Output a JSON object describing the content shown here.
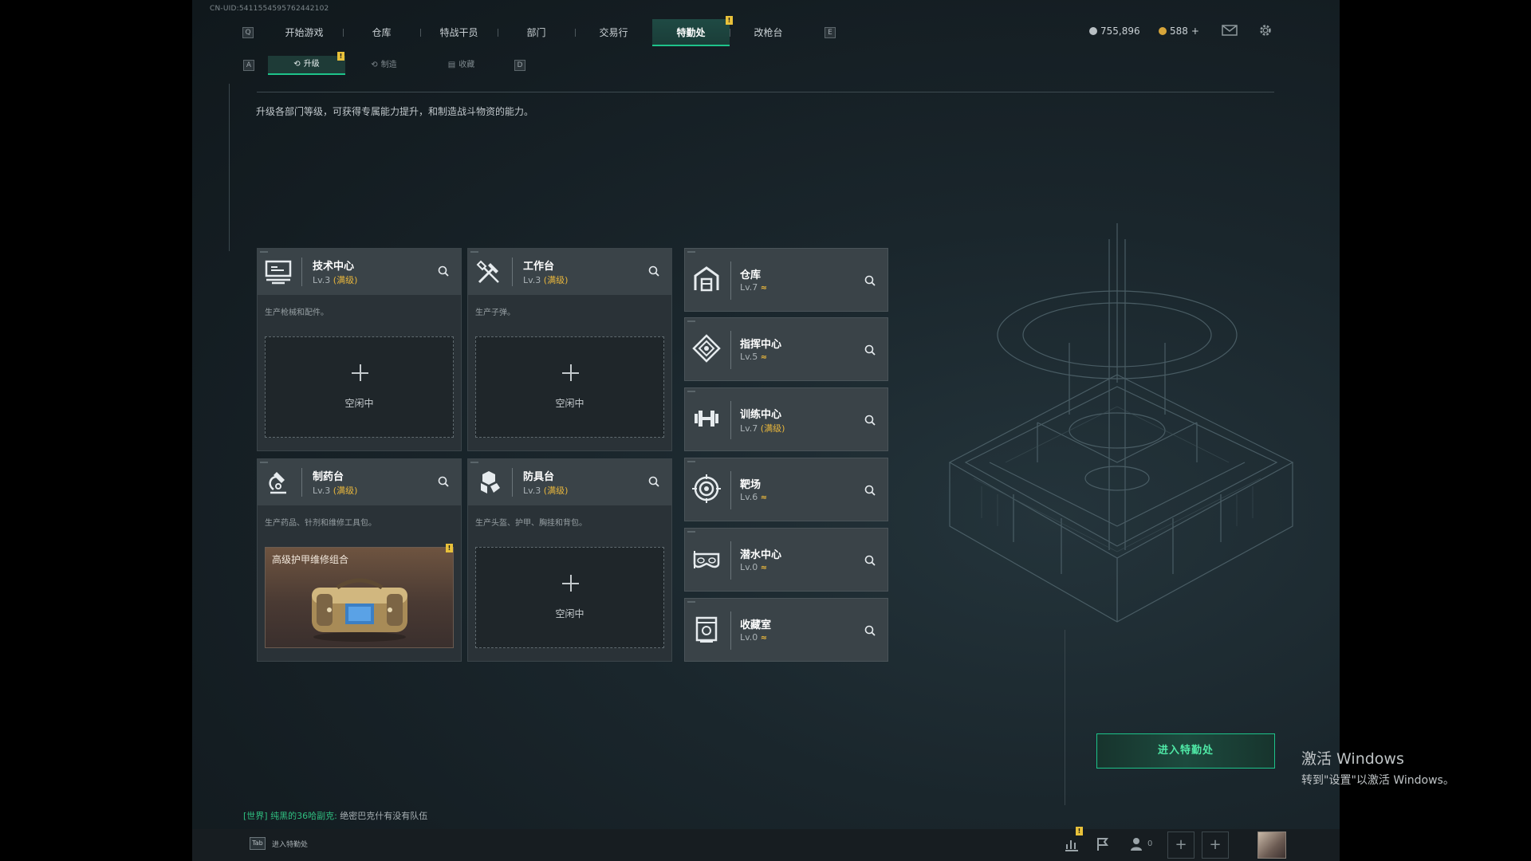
{
  "uid": "CN-UID:5411554595762442102",
  "nav": {
    "left_key": "Q",
    "right_key": "E",
    "items": [
      "开始游戏",
      "仓库",
      "特战干员",
      "部门",
      "交易行",
      "特勤处",
      "改枪台"
    ],
    "active_index": 5,
    "active_badge": "!"
  },
  "currency": {
    "coins": "755,896",
    "premium": "588",
    "premium_plus": "+",
    "coin_color": "#b9c0c4",
    "premium_color": "#d7a53a"
  },
  "top_icons": [
    "mail-icon",
    "gear-icon"
  ],
  "subnav": {
    "left_key": "A",
    "right_key": "D",
    "items": [
      "升级",
      "制造",
      "收藏"
    ],
    "active_index": 0,
    "active_badge": "!"
  },
  "description": "升级各部门等级，可获得专属能力提升，和制造战斗物资的能力。",
  "crafting": [
    {
      "title": "技术中心",
      "level": "Lv.3",
      "max": "(满级)",
      "desc": "生产枪械和配件。",
      "slot": "空闲中",
      "icon": "terminal-icon"
    },
    {
      "title": "工作台",
      "level": "Lv.3",
      "max": "(满级)",
      "desc": "生产子弹。",
      "slot": "空闲中",
      "icon": "tools-icon"
    },
    {
      "title": "制药台",
      "level": "Lv.3",
      "max": "(满级)",
      "desc": "生产药品、针剂和维修工具包。",
      "slot_item": "高级护甲维修组合",
      "slot_badge": "!",
      "icon": "microscope-icon"
    },
    {
      "title": "防具台",
      "level": "Lv.3",
      "max": "(满级)",
      "desc": "生产头盔、护甲、胸挂和背包。",
      "slot": "空闲中",
      "icon": "armor-icon"
    }
  ],
  "departments": [
    {
      "title": "仓库",
      "level": "Lv.7",
      "max": "",
      "upgradable": true,
      "icon": "warehouse-icon"
    },
    {
      "title": "指挥中心",
      "level": "Lv.5",
      "max": "",
      "upgradable": true,
      "icon": "command-icon"
    },
    {
      "title": "训练中心",
      "level": "Lv.7",
      "max": "(满级)",
      "upgradable": false,
      "icon": "dumbbell-icon"
    },
    {
      "title": "靶场",
      "level": "Lv.6",
      "max": "",
      "upgradable": true,
      "icon": "target-icon"
    },
    {
      "title": "潜水中心",
      "level": "Lv.0",
      "max": "",
      "upgradable": true,
      "icon": "diving-mask-icon"
    },
    {
      "title": "收藏室",
      "level": "Lv.0",
      "max": "",
      "upgradable": true,
      "icon": "collection-icon"
    }
  ],
  "upgrade_glyph": "≈",
  "enter_button": "进入特勤处",
  "chat": {
    "channel": "[世界]",
    "name": "纯黑的36哈副克:",
    "message": "绝密巴克什有没有队伍"
  },
  "bottom": {
    "tab_key": "Tab",
    "tab_label": "进入特勤处",
    "notif_badge": "!",
    "friends_count": "0",
    "plus_glyph": "+"
  },
  "watermark": {
    "line1": "激活 Windows",
    "line2": "转到\"设置\"以激活 Windows。"
  },
  "accent": "#1ec38a",
  "gold": "#e8b63c"
}
